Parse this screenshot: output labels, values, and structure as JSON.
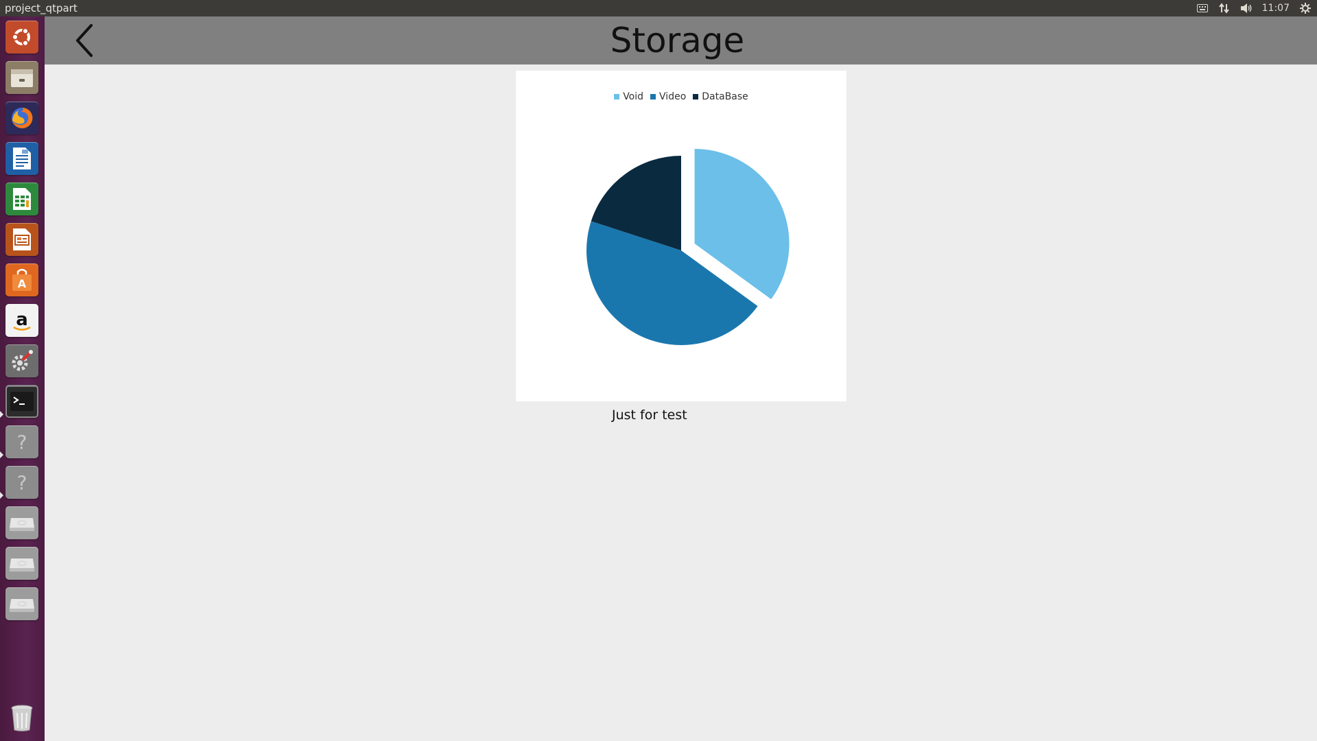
{
  "topbar": {
    "window_title": "project_qtpart",
    "clock": "11:07",
    "indicators": [
      "keyboard-icon",
      "network-icon",
      "volume-icon",
      "settings-icon"
    ]
  },
  "launcher": {
    "items": [
      {
        "name": "ubuntu-dash-icon",
        "color": "#e05a2b"
      },
      {
        "name": "files-icon",
        "color": "#b9a98c"
      },
      {
        "name": "firefox-icon",
        "color": "#e8541f"
      },
      {
        "name": "writer-icon",
        "color": "#2a6cb5"
      },
      {
        "name": "calc-icon",
        "color": "#2e8b3c"
      },
      {
        "name": "impress-icon",
        "color": "#c55a1e"
      },
      {
        "name": "software-center-icon",
        "color": "#e06a24"
      },
      {
        "name": "amazon-icon",
        "color": "#eeeeee"
      },
      {
        "name": "system-settings-icon",
        "color": "#7d7d7d"
      },
      {
        "name": "terminal-icon",
        "color": "#2b2b2b"
      },
      {
        "name": "unknown-app-icon",
        "color": "#8a8a8a"
      },
      {
        "name": "unknown-app-icon",
        "color": "#8a8a8a"
      },
      {
        "name": "drive-icon",
        "color": "#cfcfcf"
      },
      {
        "name": "drive-icon",
        "color": "#cfcfcf"
      },
      {
        "name": "drive-icon",
        "color": "#cfcfcf"
      }
    ],
    "trash": {
      "name": "trash-icon",
      "color": "#cfcfcf"
    }
  },
  "app": {
    "title": "Storage",
    "back_icon": "chevron-left-icon",
    "caption": "Just for test"
  },
  "chart_data": {
    "type": "pie",
    "slices": [
      {
        "label": "Void",
        "value": 35,
        "color": "#6bbfe9",
        "exploded": true
      },
      {
        "label": "Video",
        "value": 45,
        "color": "#1a77ae",
        "exploded": false
      },
      {
        "label": "DataBase",
        "value": 20,
        "color": "#0a2a40",
        "exploded": false
      }
    ],
    "legend_position": "top"
  }
}
